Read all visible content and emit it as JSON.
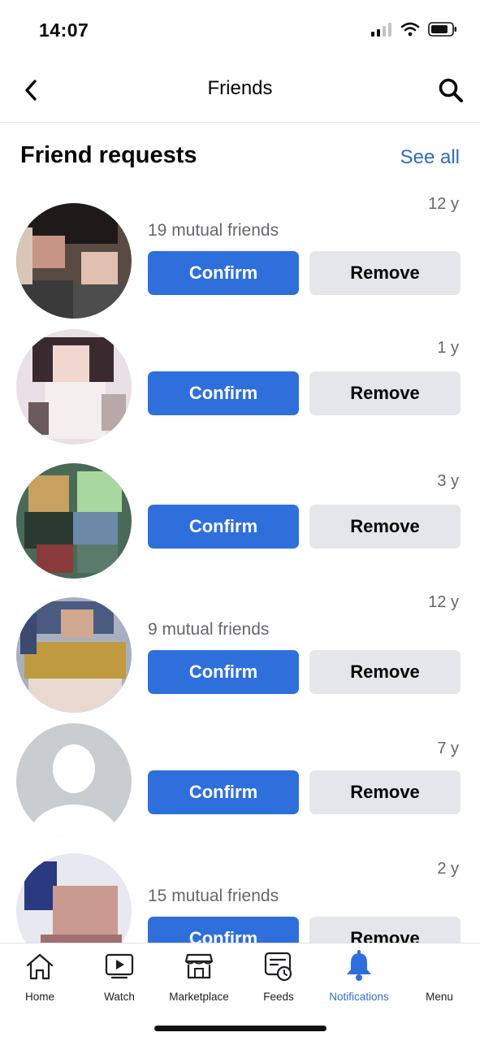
{
  "status_bar": {
    "time": "14:07"
  },
  "nav": {
    "title": "Friends"
  },
  "section": {
    "title": "Friend requests",
    "see_all": "See all"
  },
  "requests": [
    {
      "age": "12 y",
      "mutual": "19 mutual friends",
      "confirm": "Confirm",
      "remove": "Remove"
    },
    {
      "age": "1 y",
      "mutual": "",
      "confirm": "Confirm",
      "remove": "Remove"
    },
    {
      "age": "3 y",
      "mutual": "",
      "confirm": "Confirm",
      "remove": "Remove"
    },
    {
      "age": "12 y",
      "mutual": "9 mutual friends",
      "confirm": "Confirm",
      "remove": "Remove"
    },
    {
      "age": "7 y",
      "mutual": "",
      "confirm": "Confirm",
      "remove": "Remove"
    },
    {
      "age": "2 y",
      "mutual": "15 mutual friends",
      "confirm": "Confirm",
      "remove": "Remove"
    }
  ],
  "tabs": [
    {
      "label": "Home",
      "icon": "home-icon",
      "active": false
    },
    {
      "label": "Watch",
      "icon": "watch-icon",
      "active": false
    },
    {
      "label": "Marketplace",
      "icon": "marketplace-icon",
      "active": false
    },
    {
      "label": "Feeds",
      "icon": "feeds-icon",
      "active": false
    },
    {
      "label": "Notifications",
      "icon": "bell-icon",
      "active": true
    },
    {
      "label": "Menu",
      "icon": "menu-icon",
      "active": false
    }
  ],
  "colors": {
    "accent": "#2e6fdb",
    "link": "#2d6bc4",
    "secondary_button": "#e4e6eb",
    "muted_text": "#65676b"
  }
}
